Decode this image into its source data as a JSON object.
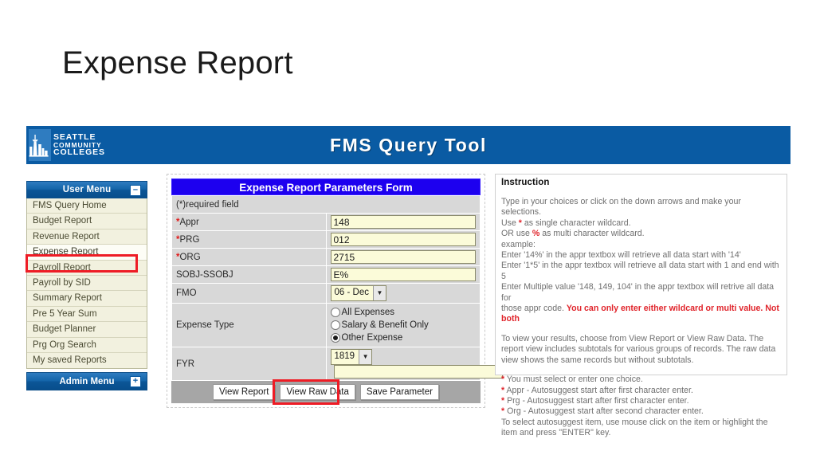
{
  "slide": {
    "title": "Expense Report"
  },
  "app": {
    "banner": {
      "title": "FMS Query Tool",
      "logo": {
        "line1": "SEATTLE",
        "line2": "COMMUNITY",
        "line3": "COLLEGES"
      }
    },
    "sidebar": {
      "user_menu_label": "User Menu",
      "user_menu_toggle": "–",
      "admin_menu_label": "Admin Menu",
      "admin_menu_toggle": "+",
      "items": [
        {
          "label": "FMS Query Home"
        },
        {
          "label": "Budget Report"
        },
        {
          "label": "Revenue Report"
        },
        {
          "label": "Expense Report"
        },
        {
          "label": "Payroll Report"
        },
        {
          "label": "Payroll by SID"
        },
        {
          "label": "Summary Report"
        },
        {
          "label": "Pre 5 Year Sum"
        },
        {
          "label": "Budget Planner"
        },
        {
          "label": "Prg Org Search"
        },
        {
          "label": "My saved Reports"
        }
      ]
    },
    "form": {
      "title": "Expense Report Parameters Form",
      "required_note": "(*)required field",
      "labels": {
        "appr": "Appr",
        "prg": "PRG",
        "org": "ORG",
        "sobj": "SOBJ-SSOBJ",
        "fmo": "FMO",
        "expense_type": "Expense Type",
        "fyr": "FYR"
      },
      "values": {
        "appr": "148",
        "prg": "012",
        "org": "2715",
        "sobj": "E%",
        "fmo": "06 - Dec",
        "fyr": "1819",
        "fyr_extra": ""
      },
      "expense_type_options": [
        {
          "label": "All Expenses",
          "selected": false
        },
        {
          "label": "Salary & Benefit Only",
          "selected": false
        },
        {
          "label": "Other Expense",
          "selected": true
        }
      ],
      "buttons": {
        "view_report": "View Report",
        "view_raw_data": "View Raw Data",
        "save_parameter": "Save Parameter"
      }
    },
    "instruction": {
      "heading": "Instruction",
      "p1_line1": "Type in your choices or click on the down arrows and make your selections.",
      "p1_line2_pre": "Use ",
      "p1_line2_sym": "*",
      "p1_line2_post": " as single character wildcard.",
      "p1_line3_pre": "OR use ",
      "p1_line3_sym": "%",
      "p1_line3_post": " as multi character wildcard.",
      "p1_line4": "example:",
      "p1_line5": "Enter '14%' in the appr textbox will retrieve all data start with '14'",
      "p1_line6": "Enter '1*5' in the appr textbox will retrieve all data start with 1 and end with 5",
      "p1_line7": "Enter Multiple value '148, 149, 104' in the appr textbox will retrive all data for",
      "p1_line8_pre": "those appr code. ",
      "p1_line8_red": "You can only enter either wildcard or multi value. Not both",
      "p2": "To view your results, choose from View Report or View Raw Data. The report view includes subtotals for various groups of records. The raw data view shows the same records but without subtotals.",
      "bullets": [
        "You must select or enter one choice.",
        "Appr - Autosuggest start after first character enter.",
        "Prg - Autosuggest start after first character enter.",
        "Org - Autosuggest start after second character enter."
      ],
      "p3": "To select autosuggest item, use mouse click on the item or highlight the item and press \"ENTER\" key."
    }
  },
  "colors": {
    "banner_blue": "#0a5ba3",
    "form_title_blue": "#1d00ef",
    "highlight_red": "#ee1c25",
    "field_yellow": "#fbfbd9",
    "menu_cream": "#f2f1df"
  }
}
